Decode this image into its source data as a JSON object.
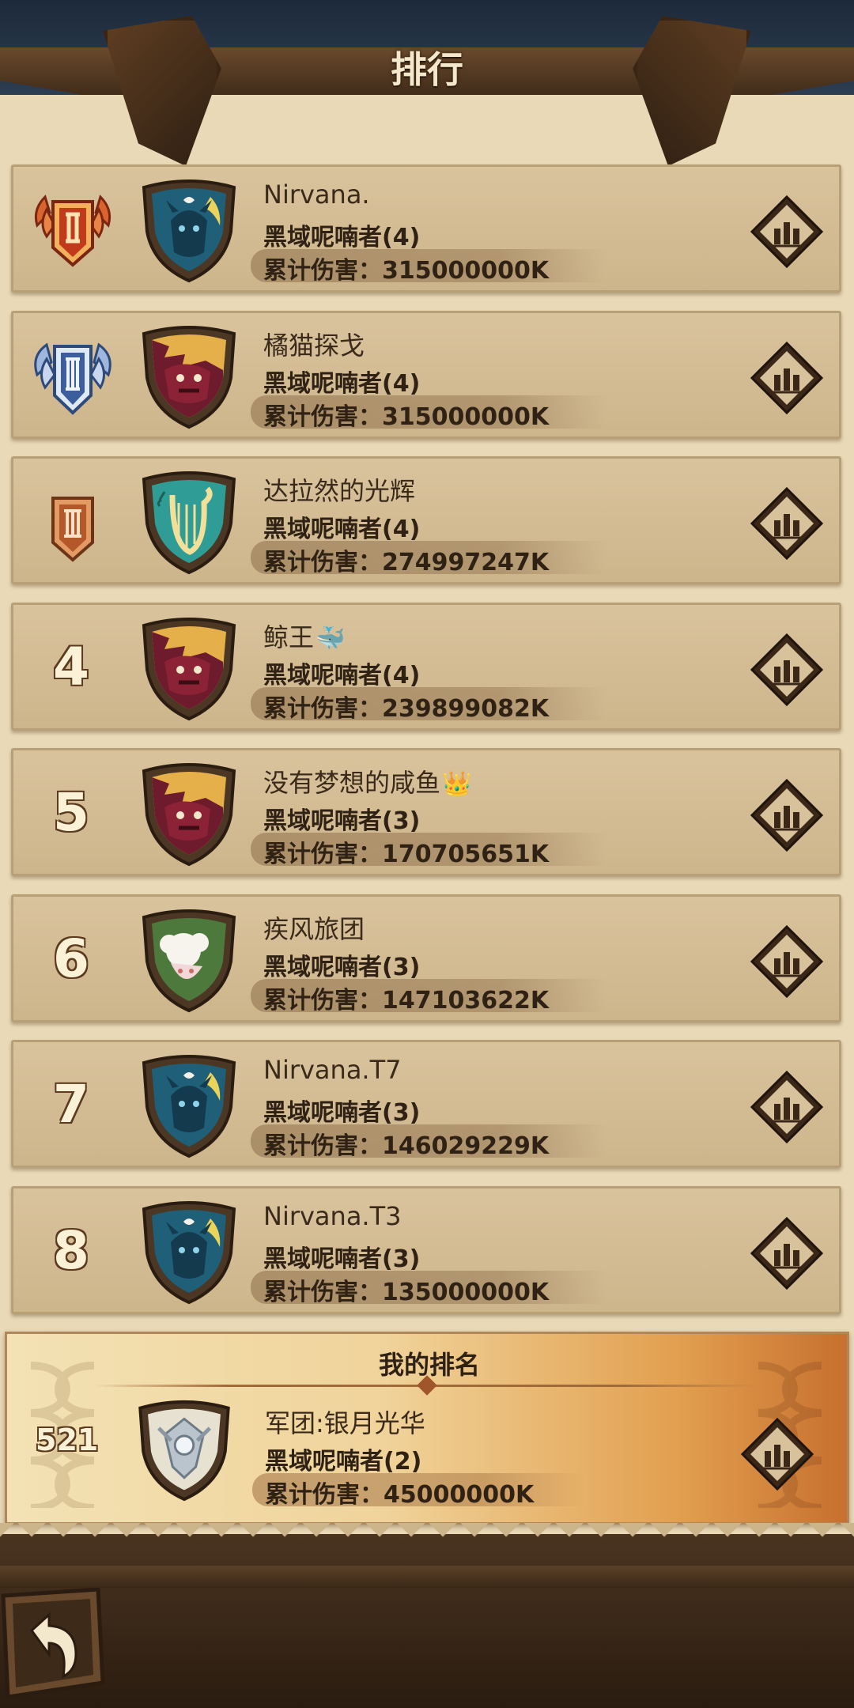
{
  "header": {
    "title": "排行"
  },
  "rows": [
    {
      "rank": "",
      "medal": "rank-1-medal",
      "emblem": "demon-knight-emblem",
      "name": "Nirvana.",
      "name_deco": "",
      "sub": "黑域呢喃者(4)",
      "damage": "累计伤害：315000000K"
    },
    {
      "rank": "",
      "medal": "rank-2-medal",
      "emblem": "red-dragon-emblem",
      "name": "橘猫探戈",
      "name_deco": "",
      "sub": "黑域呢喃者(4)",
      "damage": "累计伤害：315000000K"
    },
    {
      "rank": "",
      "medal": "rank-3-medal",
      "emblem": "harp-emblem",
      "name": "达拉然的光辉",
      "name_deco": "",
      "sub": "黑域呢喃者(4)",
      "damage": "累计伤害：274997247K"
    },
    {
      "rank": "4",
      "medal": "",
      "emblem": "red-dragon-emblem",
      "name": "鲸王",
      "name_deco": "🐳",
      "sub": "黑域呢喃者(4)",
      "damage": "累计伤害：239899082K"
    },
    {
      "rank": "5",
      "medal": "",
      "emblem": "red-dragon-emblem",
      "name": "没有梦想的咸鱼",
      "name_deco": "👑",
      "sub": "黑域呢喃者(3)",
      "damage": "累计伤害：170705651K"
    },
    {
      "rank": "6",
      "medal": "",
      "emblem": "white-cat-emblem",
      "name": "疾风旅团",
      "name_deco": "",
      "sub": "黑域呢喃者(3)",
      "damage": "累计伤害：147103622K"
    },
    {
      "rank": "7",
      "medal": "",
      "emblem": "demon-knight-emblem",
      "name": "Nirvana.T7",
      "name_deco": "",
      "sub": "黑域呢喃者(3)",
      "damage": "累计伤害：146029229K"
    },
    {
      "rank": "8",
      "medal": "",
      "emblem": "demon-knight-emblem",
      "name": "Nirvana.T3",
      "name_deco": "",
      "sub": "黑域呢喃者(3)",
      "damage": "累计伤害：135000000K"
    }
  ],
  "my_rank": {
    "title": "我的排名",
    "rank": "521",
    "emblem": "silver-crest-emblem",
    "name": "军团:银月光华",
    "sub": "黑域呢喃者(2)",
    "damage": "累计伤害：45000000K"
  },
  "icons": {
    "stats": "bar-chart-icon",
    "back": "back-arrow-icon"
  }
}
